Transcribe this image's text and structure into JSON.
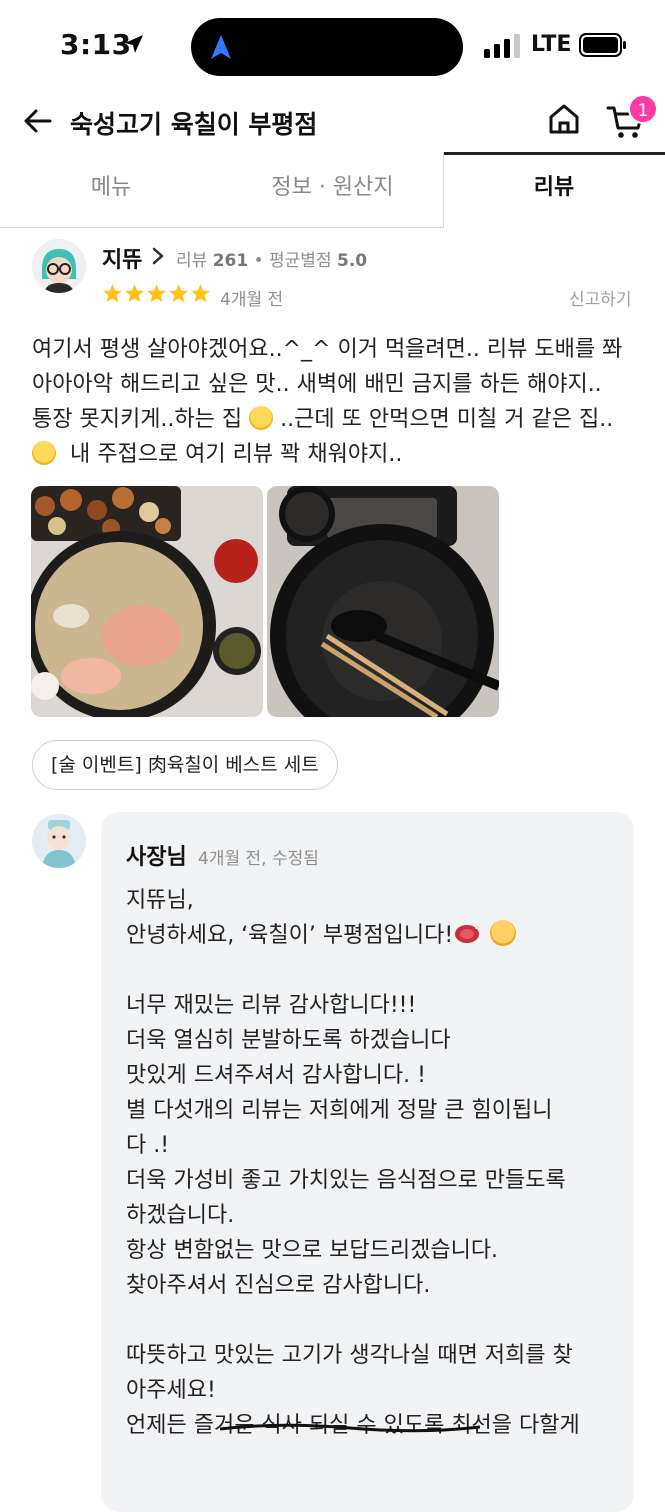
{
  "status_bar": {
    "time": "3:13",
    "network": "LTE"
  },
  "header": {
    "title": "숙성고기 육칠이 부평점",
    "cart_count": "1"
  },
  "tabs": [
    {
      "label": "메뉴",
      "active": false
    },
    {
      "label": "정보 · 원산지",
      "active": false
    },
    {
      "label": "리뷰",
      "active": true
    }
  ],
  "review": {
    "reviewer": "지뜌",
    "review_count_label": "리뷰",
    "review_count": "261",
    "avg_rating_label": "평균별점",
    "avg_rating": "5.0",
    "stars": 5,
    "date": "4개월 전",
    "report_label": "신고하기",
    "text_lines": [
      "여기서 평생 살아야겠어요..^_^ 이거 먹을려면.. 리뷰 도배를 쫘",
      "아아아악 해드리고 싶은 맛.. 새벽에 배민 금지를 하든 해야지..",
      "통장 못지키게..하는 집",
      "..근데 또 안먹으면 미칠 거 같은 집..",
      "내 주접으로 여기 리뷰 꽉 채워야지.."
    ],
    "menu_chip": "[술 이벤트] 肉육칠이 베스트 세트"
  },
  "owner_reply": {
    "name": "사장님",
    "meta": "4개월 전, 수정됨",
    "lines": [
      "지뜌님,",
      "안녕하세요, ‘육칠이’ 부평점입니다!",
      "",
      "너무 재밌는 리뷰 감사합니다!!!",
      "더욱 열심히 분발하도록  하겠습니다",
      "맛있게 드셔주셔서 감사합니다. !",
      "별 다섯개의 리뷰는 저희에게 정말 큰 힘이됩니",
      "다 .!",
      "더욱 가성비 좋고 가치있는 음식점으로 만들도록",
      "하겠습니다.",
      "항상 변함없는 맛으로 보답드리겠습니다.",
      "찾아주셔서 진심으로 감사합니다.",
      "",
      "따뜻하고 맛있는 고기가 생각나실 때면 저희를 찾",
      "아주세요!",
      "언제든 즐거운 식사 되실 수 있도록 최선을 다할게"
    ]
  },
  "colors": {
    "accent_pink": "#ff3aa6",
    "star_yellow": "#ffc21a",
    "reply_bg": "#f2f3f5"
  }
}
